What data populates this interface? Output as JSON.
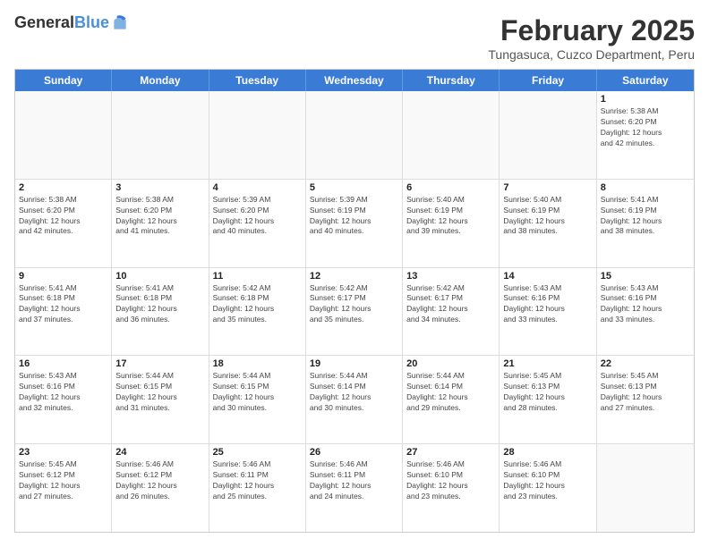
{
  "header": {
    "logo_line1": "General",
    "logo_line2": "Blue",
    "month_title": "February 2025",
    "location": "Tungasuca, Cuzco Department, Peru"
  },
  "days_of_week": [
    "Sunday",
    "Monday",
    "Tuesday",
    "Wednesday",
    "Thursday",
    "Friday",
    "Saturday"
  ],
  "weeks": [
    [
      {
        "day": "",
        "info": ""
      },
      {
        "day": "",
        "info": ""
      },
      {
        "day": "",
        "info": ""
      },
      {
        "day": "",
        "info": ""
      },
      {
        "day": "",
        "info": ""
      },
      {
        "day": "",
        "info": ""
      },
      {
        "day": "1",
        "info": "Sunrise: 5:38 AM\nSunset: 6:20 PM\nDaylight: 12 hours\nand 42 minutes."
      }
    ],
    [
      {
        "day": "2",
        "info": "Sunrise: 5:38 AM\nSunset: 6:20 PM\nDaylight: 12 hours\nand 42 minutes."
      },
      {
        "day": "3",
        "info": "Sunrise: 5:38 AM\nSunset: 6:20 PM\nDaylight: 12 hours\nand 41 minutes."
      },
      {
        "day": "4",
        "info": "Sunrise: 5:39 AM\nSunset: 6:20 PM\nDaylight: 12 hours\nand 40 minutes."
      },
      {
        "day": "5",
        "info": "Sunrise: 5:39 AM\nSunset: 6:19 PM\nDaylight: 12 hours\nand 40 minutes."
      },
      {
        "day": "6",
        "info": "Sunrise: 5:40 AM\nSunset: 6:19 PM\nDaylight: 12 hours\nand 39 minutes."
      },
      {
        "day": "7",
        "info": "Sunrise: 5:40 AM\nSunset: 6:19 PM\nDaylight: 12 hours\nand 38 minutes."
      },
      {
        "day": "8",
        "info": "Sunrise: 5:41 AM\nSunset: 6:19 PM\nDaylight: 12 hours\nand 38 minutes."
      }
    ],
    [
      {
        "day": "9",
        "info": "Sunrise: 5:41 AM\nSunset: 6:18 PM\nDaylight: 12 hours\nand 37 minutes."
      },
      {
        "day": "10",
        "info": "Sunrise: 5:41 AM\nSunset: 6:18 PM\nDaylight: 12 hours\nand 36 minutes."
      },
      {
        "day": "11",
        "info": "Sunrise: 5:42 AM\nSunset: 6:18 PM\nDaylight: 12 hours\nand 35 minutes."
      },
      {
        "day": "12",
        "info": "Sunrise: 5:42 AM\nSunset: 6:17 PM\nDaylight: 12 hours\nand 35 minutes."
      },
      {
        "day": "13",
        "info": "Sunrise: 5:42 AM\nSunset: 6:17 PM\nDaylight: 12 hours\nand 34 minutes."
      },
      {
        "day": "14",
        "info": "Sunrise: 5:43 AM\nSunset: 6:16 PM\nDaylight: 12 hours\nand 33 minutes."
      },
      {
        "day": "15",
        "info": "Sunrise: 5:43 AM\nSunset: 6:16 PM\nDaylight: 12 hours\nand 33 minutes."
      }
    ],
    [
      {
        "day": "16",
        "info": "Sunrise: 5:43 AM\nSunset: 6:16 PM\nDaylight: 12 hours\nand 32 minutes."
      },
      {
        "day": "17",
        "info": "Sunrise: 5:44 AM\nSunset: 6:15 PM\nDaylight: 12 hours\nand 31 minutes."
      },
      {
        "day": "18",
        "info": "Sunrise: 5:44 AM\nSunset: 6:15 PM\nDaylight: 12 hours\nand 30 minutes."
      },
      {
        "day": "19",
        "info": "Sunrise: 5:44 AM\nSunset: 6:14 PM\nDaylight: 12 hours\nand 30 minutes."
      },
      {
        "day": "20",
        "info": "Sunrise: 5:44 AM\nSunset: 6:14 PM\nDaylight: 12 hours\nand 29 minutes."
      },
      {
        "day": "21",
        "info": "Sunrise: 5:45 AM\nSunset: 6:13 PM\nDaylight: 12 hours\nand 28 minutes."
      },
      {
        "day": "22",
        "info": "Sunrise: 5:45 AM\nSunset: 6:13 PM\nDaylight: 12 hours\nand 27 minutes."
      }
    ],
    [
      {
        "day": "23",
        "info": "Sunrise: 5:45 AM\nSunset: 6:12 PM\nDaylight: 12 hours\nand 27 minutes."
      },
      {
        "day": "24",
        "info": "Sunrise: 5:46 AM\nSunset: 6:12 PM\nDaylight: 12 hours\nand 26 minutes."
      },
      {
        "day": "25",
        "info": "Sunrise: 5:46 AM\nSunset: 6:11 PM\nDaylight: 12 hours\nand 25 minutes."
      },
      {
        "day": "26",
        "info": "Sunrise: 5:46 AM\nSunset: 6:11 PM\nDaylight: 12 hours\nand 24 minutes."
      },
      {
        "day": "27",
        "info": "Sunrise: 5:46 AM\nSunset: 6:10 PM\nDaylight: 12 hours\nand 23 minutes."
      },
      {
        "day": "28",
        "info": "Sunrise: 5:46 AM\nSunset: 6:10 PM\nDaylight: 12 hours\nand 23 minutes."
      },
      {
        "day": "",
        "info": ""
      }
    ]
  ]
}
